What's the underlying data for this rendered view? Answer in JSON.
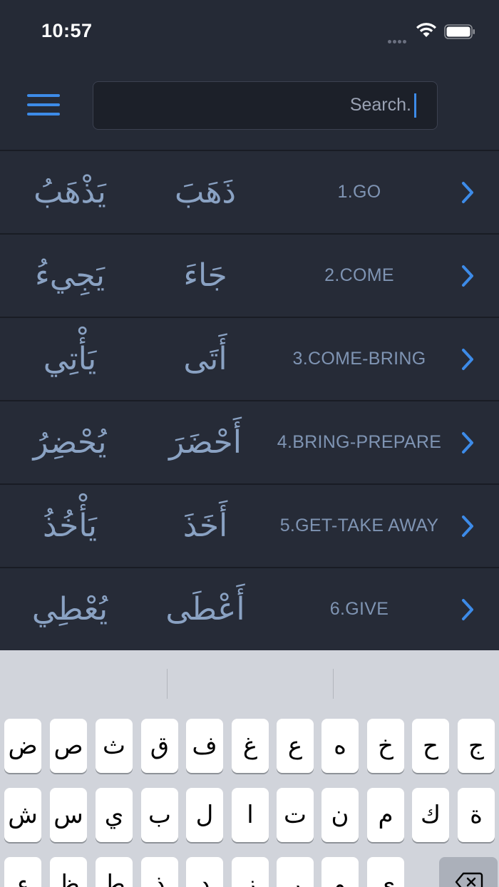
{
  "status_bar": {
    "time": "10:57"
  },
  "header": {
    "menu_icon": "hamburger-menu-icon",
    "search": {
      "value": "Search.",
      "placeholder": "Search."
    }
  },
  "verbs": [
    {
      "number": "1",
      "meaning": "1.GO",
      "perfect": "ذَهَبَ",
      "imperfect": "يَذْهَبُ"
    },
    {
      "number": "2",
      "meaning": "2.COME",
      "perfect": "جَاءَ",
      "imperfect": "يَجِيءُ"
    },
    {
      "number": "3",
      "meaning": "3.COME-BRING",
      "perfect": "أَتَى",
      "imperfect": "يَأْتِي"
    },
    {
      "number": "4",
      "meaning": "4.BRING-PREPARE",
      "perfect": "أَحْضَرَ",
      "imperfect": "يُحْضِرُ"
    },
    {
      "number": "5",
      "meaning": "5.GET-TAKE AWAY",
      "perfect": "أَخَذَ",
      "imperfect": "يَأْخُذُ"
    },
    {
      "number": "6",
      "meaning": "6.GIVE",
      "perfect": "أَعْطَى",
      "imperfect": "يُعْطِي"
    }
  ],
  "keyboard": {
    "row1": [
      "ض",
      "ص",
      "ث",
      "ق",
      "ف",
      "غ",
      "ع",
      "ه",
      "خ",
      "ح",
      "ج"
    ],
    "row2": [
      "ش",
      "س",
      "ي",
      "ب",
      "ل",
      "ا",
      "ت",
      "ن",
      "م",
      "ك",
      "ة"
    ],
    "row3": [
      "ء",
      "ظ",
      "ط",
      "ذ",
      "د",
      "ز",
      "ر",
      "و",
      "ى"
    ],
    "delete_icon": "backspace-icon"
  },
  "colors": {
    "background": "#252a36",
    "accent": "#3d8be8",
    "arabic_text": "#8aa2c3",
    "meaning_text": "#7f94b3"
  }
}
